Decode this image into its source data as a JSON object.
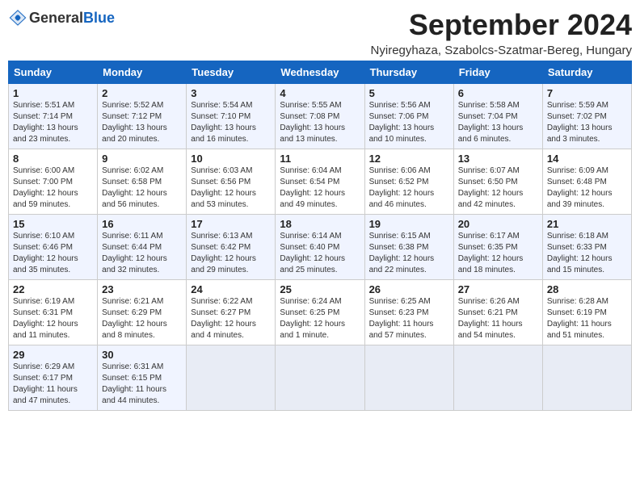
{
  "header": {
    "logo_general": "General",
    "logo_blue": "Blue",
    "month_title": "September 2024",
    "location": "Nyiregyhaza, Szabolcs-Szatmar-Bereg, Hungary"
  },
  "days_of_week": [
    "Sunday",
    "Monday",
    "Tuesday",
    "Wednesday",
    "Thursday",
    "Friday",
    "Saturday"
  ],
  "weeks": [
    [
      {
        "day": "1",
        "sunrise": "Sunrise: 5:51 AM",
        "sunset": "Sunset: 7:14 PM",
        "daylight": "Daylight: 13 hours and 23 minutes."
      },
      {
        "day": "2",
        "sunrise": "Sunrise: 5:52 AM",
        "sunset": "Sunset: 7:12 PM",
        "daylight": "Daylight: 13 hours and 20 minutes."
      },
      {
        "day": "3",
        "sunrise": "Sunrise: 5:54 AM",
        "sunset": "Sunset: 7:10 PM",
        "daylight": "Daylight: 13 hours and 16 minutes."
      },
      {
        "day": "4",
        "sunrise": "Sunrise: 5:55 AM",
        "sunset": "Sunset: 7:08 PM",
        "daylight": "Daylight: 13 hours and 13 minutes."
      },
      {
        "day": "5",
        "sunrise": "Sunrise: 5:56 AM",
        "sunset": "Sunset: 7:06 PM",
        "daylight": "Daylight: 13 hours and 10 minutes."
      },
      {
        "day": "6",
        "sunrise": "Sunrise: 5:58 AM",
        "sunset": "Sunset: 7:04 PM",
        "daylight": "Daylight: 13 hours and 6 minutes."
      },
      {
        "day": "7",
        "sunrise": "Sunrise: 5:59 AM",
        "sunset": "Sunset: 7:02 PM",
        "daylight": "Daylight: 13 hours and 3 minutes."
      }
    ],
    [
      {
        "day": "8",
        "sunrise": "Sunrise: 6:00 AM",
        "sunset": "Sunset: 7:00 PM",
        "daylight": "Daylight: 12 hours and 59 minutes."
      },
      {
        "day": "9",
        "sunrise": "Sunrise: 6:02 AM",
        "sunset": "Sunset: 6:58 PM",
        "daylight": "Daylight: 12 hours and 56 minutes."
      },
      {
        "day": "10",
        "sunrise": "Sunrise: 6:03 AM",
        "sunset": "Sunset: 6:56 PM",
        "daylight": "Daylight: 12 hours and 53 minutes."
      },
      {
        "day": "11",
        "sunrise": "Sunrise: 6:04 AM",
        "sunset": "Sunset: 6:54 PM",
        "daylight": "Daylight: 12 hours and 49 minutes."
      },
      {
        "day": "12",
        "sunrise": "Sunrise: 6:06 AM",
        "sunset": "Sunset: 6:52 PM",
        "daylight": "Daylight: 12 hours and 46 minutes."
      },
      {
        "day": "13",
        "sunrise": "Sunrise: 6:07 AM",
        "sunset": "Sunset: 6:50 PM",
        "daylight": "Daylight: 12 hours and 42 minutes."
      },
      {
        "day": "14",
        "sunrise": "Sunrise: 6:09 AM",
        "sunset": "Sunset: 6:48 PM",
        "daylight": "Daylight: 12 hours and 39 minutes."
      }
    ],
    [
      {
        "day": "15",
        "sunrise": "Sunrise: 6:10 AM",
        "sunset": "Sunset: 6:46 PM",
        "daylight": "Daylight: 12 hours and 35 minutes."
      },
      {
        "day": "16",
        "sunrise": "Sunrise: 6:11 AM",
        "sunset": "Sunset: 6:44 PM",
        "daylight": "Daylight: 12 hours and 32 minutes."
      },
      {
        "day": "17",
        "sunrise": "Sunrise: 6:13 AM",
        "sunset": "Sunset: 6:42 PM",
        "daylight": "Daylight: 12 hours and 29 minutes."
      },
      {
        "day": "18",
        "sunrise": "Sunrise: 6:14 AM",
        "sunset": "Sunset: 6:40 PM",
        "daylight": "Daylight: 12 hours and 25 minutes."
      },
      {
        "day": "19",
        "sunrise": "Sunrise: 6:15 AM",
        "sunset": "Sunset: 6:38 PM",
        "daylight": "Daylight: 12 hours and 22 minutes."
      },
      {
        "day": "20",
        "sunrise": "Sunrise: 6:17 AM",
        "sunset": "Sunset: 6:35 PM",
        "daylight": "Daylight: 12 hours and 18 minutes."
      },
      {
        "day": "21",
        "sunrise": "Sunrise: 6:18 AM",
        "sunset": "Sunset: 6:33 PM",
        "daylight": "Daylight: 12 hours and 15 minutes."
      }
    ],
    [
      {
        "day": "22",
        "sunrise": "Sunrise: 6:19 AM",
        "sunset": "Sunset: 6:31 PM",
        "daylight": "Daylight: 12 hours and 11 minutes."
      },
      {
        "day": "23",
        "sunrise": "Sunrise: 6:21 AM",
        "sunset": "Sunset: 6:29 PM",
        "daylight": "Daylight: 12 hours and 8 minutes."
      },
      {
        "day": "24",
        "sunrise": "Sunrise: 6:22 AM",
        "sunset": "Sunset: 6:27 PM",
        "daylight": "Daylight: 12 hours and 4 minutes."
      },
      {
        "day": "25",
        "sunrise": "Sunrise: 6:24 AM",
        "sunset": "Sunset: 6:25 PM",
        "daylight": "Daylight: 12 hours and 1 minute."
      },
      {
        "day": "26",
        "sunrise": "Sunrise: 6:25 AM",
        "sunset": "Sunset: 6:23 PM",
        "daylight": "Daylight: 11 hours and 57 minutes."
      },
      {
        "day": "27",
        "sunrise": "Sunrise: 6:26 AM",
        "sunset": "Sunset: 6:21 PM",
        "daylight": "Daylight: 11 hours and 54 minutes."
      },
      {
        "day": "28",
        "sunrise": "Sunrise: 6:28 AM",
        "sunset": "Sunset: 6:19 PM",
        "daylight": "Daylight: 11 hours and 51 minutes."
      }
    ],
    [
      {
        "day": "29",
        "sunrise": "Sunrise: 6:29 AM",
        "sunset": "Sunset: 6:17 PM",
        "daylight": "Daylight: 11 hours and 47 minutes."
      },
      {
        "day": "30",
        "sunrise": "Sunrise: 6:31 AM",
        "sunset": "Sunset: 6:15 PM",
        "daylight": "Daylight: 11 hours and 44 minutes."
      },
      null,
      null,
      null,
      null,
      null
    ]
  ]
}
